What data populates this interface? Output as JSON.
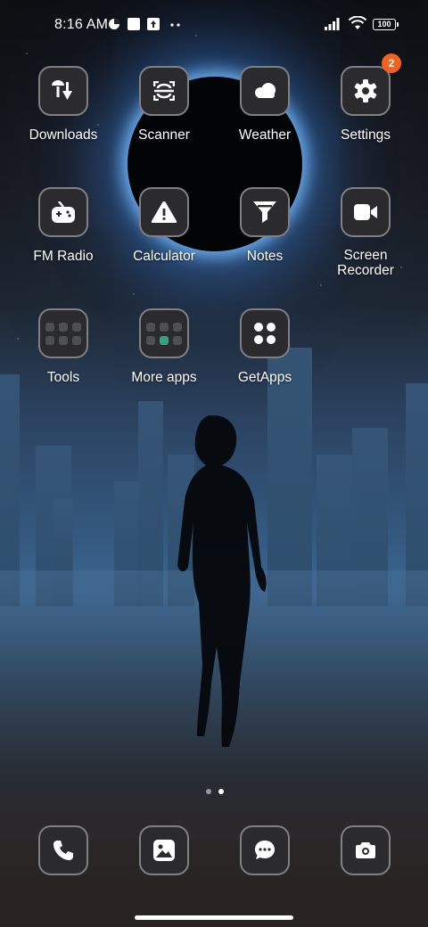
{
  "status_bar": {
    "time": "8:16 AM",
    "battery": "100",
    "icons": [
      "data-saver-icon",
      "notification-square-icon",
      "upload-icon",
      "more-dots-icon",
      "signal-icon",
      "wifi-icon",
      "battery-icon"
    ]
  },
  "apps": [
    {
      "label": "Downloads",
      "icon": "downloads-icon"
    },
    {
      "label": "Scanner",
      "icon": "scanner-icon"
    },
    {
      "label": "Weather",
      "icon": "weather-icon"
    },
    {
      "label": "Settings",
      "icon": "gear-icon",
      "badge": "2"
    },
    {
      "label": "FM Radio",
      "icon": "radio-icon"
    },
    {
      "label": "Calculator",
      "icon": "warning-icon"
    },
    {
      "label": "Notes",
      "icon": "funnel-icon"
    },
    {
      "label": "Screen\nRecorder",
      "icon": "video-camera-icon"
    },
    {
      "label": "Tools",
      "icon": "folder-icon"
    },
    {
      "label": "More apps",
      "icon": "folder-icon"
    },
    {
      "label": "GetApps",
      "icon": "getapps-icon"
    }
  ],
  "page_indicator": {
    "pages": 2,
    "active": 2
  },
  "dock": [
    {
      "name": "phone",
      "icon": "phone-icon"
    },
    {
      "name": "gallery",
      "icon": "gallery-icon"
    },
    {
      "name": "messages",
      "icon": "chat-icon"
    },
    {
      "name": "camera",
      "icon": "camera-icon"
    }
  ],
  "colors": {
    "badge": "#f26222",
    "tile_bg": "#2b2b2e",
    "tile_border": "#7e8084"
  }
}
